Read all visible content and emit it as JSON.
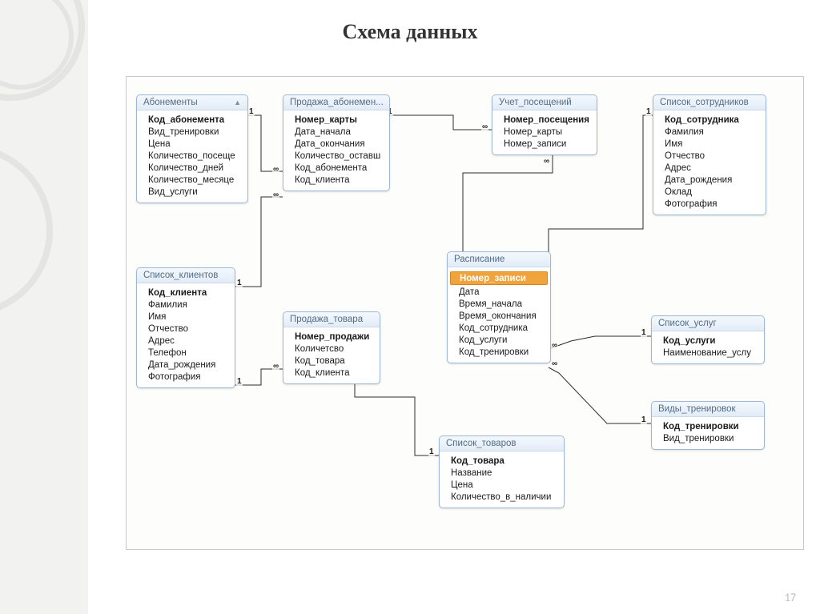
{
  "title": "Схема данных",
  "slide_number": "17",
  "tables": {
    "abon": {
      "title": "Абонементы",
      "fields": [
        {
          "n": "Код_абонемента",
          "pk": true
        },
        {
          "n": "Вид_тренировки"
        },
        {
          "n": "Цена"
        },
        {
          "n": "Количество_посеще"
        },
        {
          "n": "Количество_дней"
        },
        {
          "n": "Количество_месяце"
        },
        {
          "n": "Вид_услуги"
        }
      ]
    },
    "sale_abon": {
      "title": "Продажа_абонемен...",
      "fields": [
        {
          "n": "Номер_карты",
          "pk": true
        },
        {
          "n": "Дата_начала"
        },
        {
          "n": "Дата_окончания"
        },
        {
          "n": "Количество_оставш"
        },
        {
          "n": "Код_абонемента"
        },
        {
          "n": "Код_клиента"
        }
      ]
    },
    "visits": {
      "title": "Учет_посещений",
      "fields": [
        {
          "n": "Номер_посещения",
          "pk": true
        },
        {
          "n": "Номер_карты"
        },
        {
          "n": "Номер_записи"
        }
      ]
    },
    "staff": {
      "title": "Список_сотрудников",
      "fields": [
        {
          "n": "Код_сотрудника",
          "pk": true
        },
        {
          "n": "Фамилия"
        },
        {
          "n": "Имя"
        },
        {
          "n": "Отчество"
        },
        {
          "n": "Адрес"
        },
        {
          "n": "Дата_рождения"
        },
        {
          "n": "Оклад"
        },
        {
          "n": "Фотография"
        }
      ]
    },
    "clients": {
      "title": "Список_клиентов",
      "fields": [
        {
          "n": "Код_клиента",
          "pk": true
        },
        {
          "n": "Фамилия"
        },
        {
          "n": "Имя"
        },
        {
          "n": "Отчество"
        },
        {
          "n": "Адрес"
        },
        {
          "n": "Телефон"
        },
        {
          "n": "Дата_рождения"
        },
        {
          "n": "Фотография"
        }
      ]
    },
    "sale_goods": {
      "title": "Продажа_товара",
      "fields": [
        {
          "n": "Номер_продажи",
          "pk": true
        },
        {
          "n": "Количетсво"
        },
        {
          "n": "Код_товара"
        },
        {
          "n": "Код_клиента"
        }
      ]
    },
    "schedule": {
      "title": "Расписание",
      "fields": [
        {
          "n": "Номер_записи",
          "pk": true,
          "sel": true
        },
        {
          "n": "Дата"
        },
        {
          "n": "Время_начала"
        },
        {
          "n": "Время_окончания"
        },
        {
          "n": "Код_сотрудника"
        },
        {
          "n": "Код_услуги"
        },
        {
          "n": "Код_тренировки"
        }
      ]
    },
    "goods": {
      "title": "Список_товаров",
      "fields": [
        {
          "n": "Код_товара",
          "pk": true
        },
        {
          "n": "Название"
        },
        {
          "n": "Цена"
        },
        {
          "n": "Количество_в_наличии"
        }
      ]
    },
    "services": {
      "title": "Список_услуг",
      "fields": [
        {
          "n": "Код_услуги",
          "pk": true
        },
        {
          "n": "Наименование_услу"
        }
      ]
    },
    "trainings": {
      "title": "Виды_тренировок",
      "fields": [
        {
          "n": "Код_тренировки",
          "pk": true
        },
        {
          "n": "Вид_тренировки"
        }
      ]
    }
  },
  "one": "1",
  "many": "∞"
}
